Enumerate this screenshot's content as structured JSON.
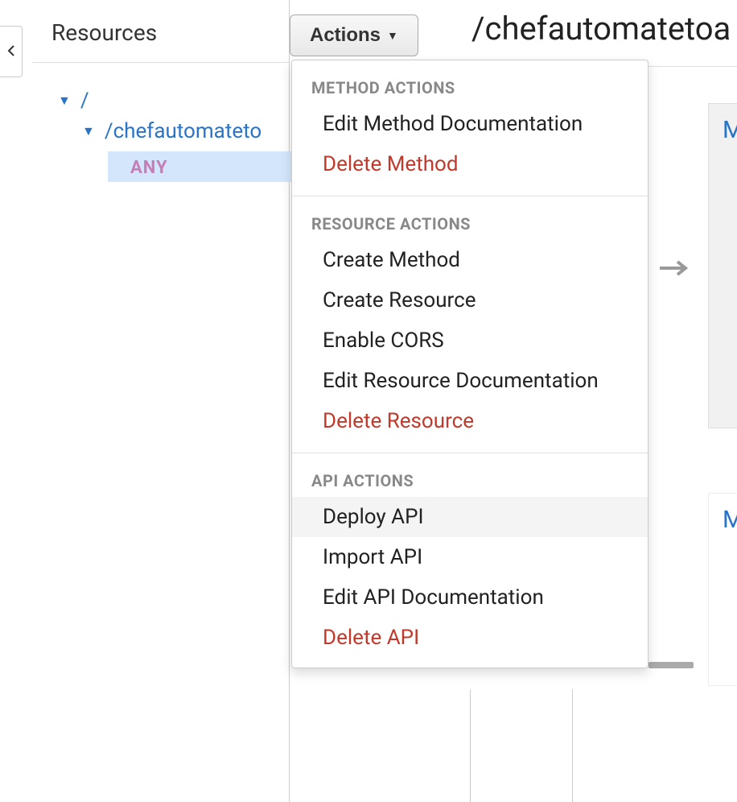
{
  "sidebar": {
    "title": "Resources",
    "root_label": "/",
    "child_label": "/chefautomateto",
    "method_label": "ANY"
  },
  "actions_button": "Actions",
  "resource_title": "/chefautomatetoa",
  "dropdown": {
    "section1_header": "METHOD ACTIONS",
    "section1": {
      "edit_method_doc": "Edit Method Documentation",
      "delete_method": "Delete Method"
    },
    "section2_header": "RESOURCE ACTIONS",
    "section2": {
      "create_method": "Create Method",
      "create_resource": "Create Resource",
      "enable_cors": "Enable CORS",
      "edit_resource_doc": "Edit Resource Documentation",
      "delete_resource": "Delete Resource"
    },
    "section3_header": "API ACTIONS",
    "section3": {
      "deploy_api": "Deploy API",
      "import_api": "Import API",
      "edit_api_doc": "Edit API Documentation",
      "delete_api": "Delete API"
    }
  },
  "right_panel": {
    "link1": "M",
    "link2": "M"
  }
}
